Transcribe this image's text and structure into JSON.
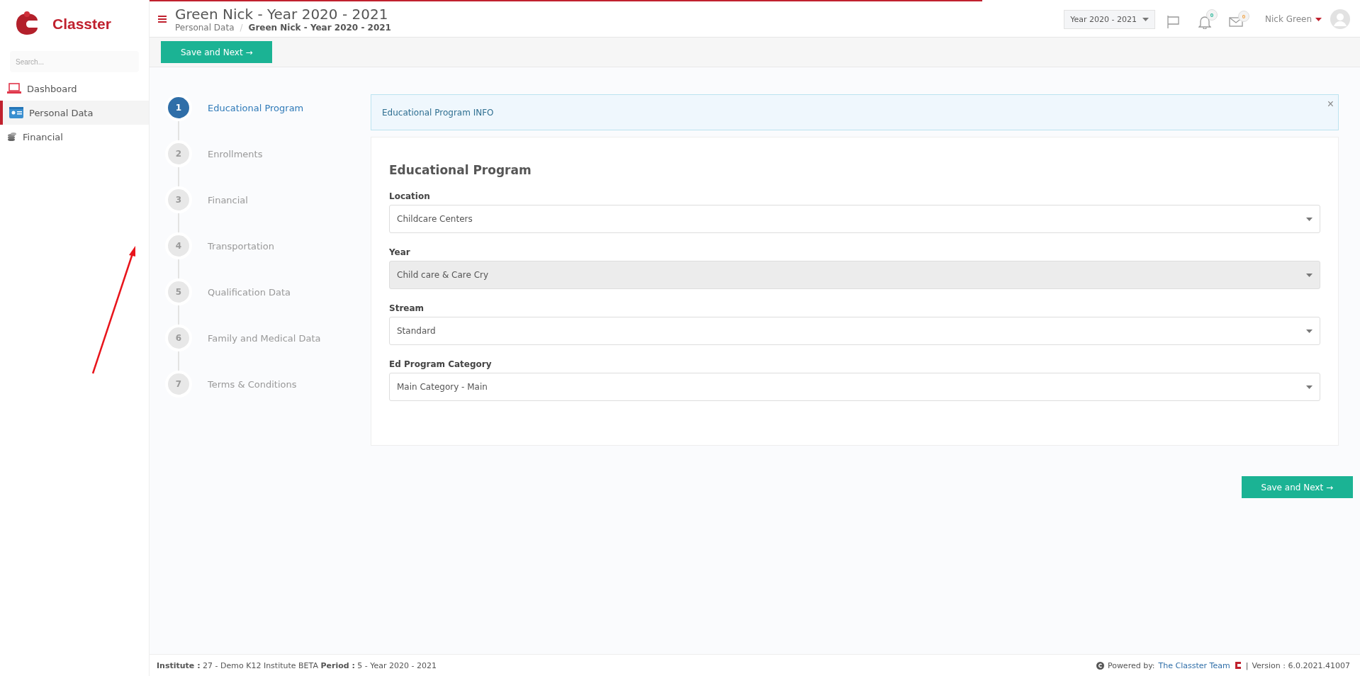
{
  "brand": {
    "name": "Classter"
  },
  "sidebar": {
    "search": {
      "placeholder": "Search..."
    },
    "items": [
      {
        "label": "Dashboard",
        "selected": false
      },
      {
        "label": "Personal Data",
        "selected": true
      },
      {
        "label": "Financial",
        "selected": false
      }
    ]
  },
  "header": {
    "title": "Green Nick - Year 2020 - 2021",
    "breadcrumb": [
      "Personal Data",
      "Green Nick - Year 2020 - 2021"
    ],
    "breadcrumb_separator": "/",
    "year_select": "Year 2020 - 2021",
    "notifications": "0",
    "messages": "0",
    "user": "Nick Green"
  },
  "toolbar": {
    "button": "Save and Next →"
  },
  "steps": [
    {
      "number": "1",
      "label": "Educational Program",
      "selected": true
    },
    {
      "number": "2",
      "label": "Enrollments",
      "selected": false
    },
    {
      "number": "3",
      "label": "Financial",
      "selected": false
    },
    {
      "number": "4",
      "label": "Transportation",
      "selected": false
    },
    {
      "number": "5",
      "label": "Qualification Data",
      "selected": false
    },
    {
      "number": "6",
      "label": "Family and Medical Data",
      "selected": false
    },
    {
      "number": "7",
      "label": "Terms & Conditions",
      "selected": false
    }
  ],
  "info": {
    "text": "Educational Program INFO",
    "close": "×"
  },
  "form": {
    "title": "Educational Program",
    "fields": [
      {
        "label": "Location",
        "value": "Childcare Centers",
        "disabled": false
      },
      {
        "label": "Year",
        "value": "Child care & Care Cry",
        "disabled": true
      },
      {
        "label": "Stream",
        "value": "Standard",
        "disabled": false
      },
      {
        "label": "Ed Program Category",
        "value": "Main Category - Main",
        "disabled": false
      }
    ]
  },
  "bottom_button": "Save and Next →",
  "footer": {
    "left": "**Institute :** 27 - Demo K12 Institute BETA **Period :** 5 - Year 2020 - 2021",
    "powered": "Powered by:",
    "link": "The Classter Team",
    "separator": "|",
    "version": "Version : 6.0.2021.41007"
  }
}
